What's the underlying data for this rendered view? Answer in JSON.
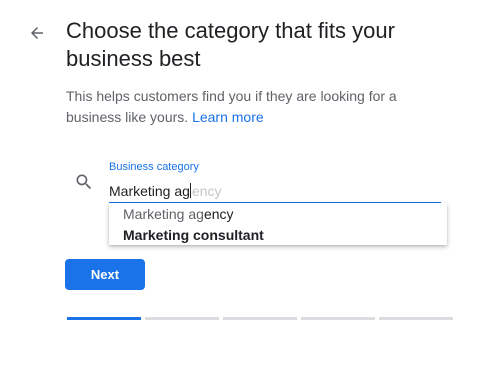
{
  "header": {
    "back_icon": "arrow-back-icon",
    "title": "Choose the category that fits your business best"
  },
  "intro": {
    "text": "This helps customers find you if they are looking for a business like yours.",
    "link_label": "Learn more"
  },
  "category_field": {
    "label": "Business category",
    "value": "Marketing ag",
    "autocomplete_ghost": "ency",
    "icon": "search-icon"
  },
  "suggestions": [
    {
      "match": "Marketing ag",
      "rest": "ency"
    },
    {
      "match": "Marketing ",
      "rest": "consultant"
    }
  ],
  "actions": {
    "next_label": "Next"
  },
  "progress": {
    "steps_total": 5,
    "steps_completed": 1
  },
  "colors": {
    "accent": "#1a73e8",
    "title": "#202124",
    "body": "#5f6368",
    "track": "#dadce0"
  }
}
